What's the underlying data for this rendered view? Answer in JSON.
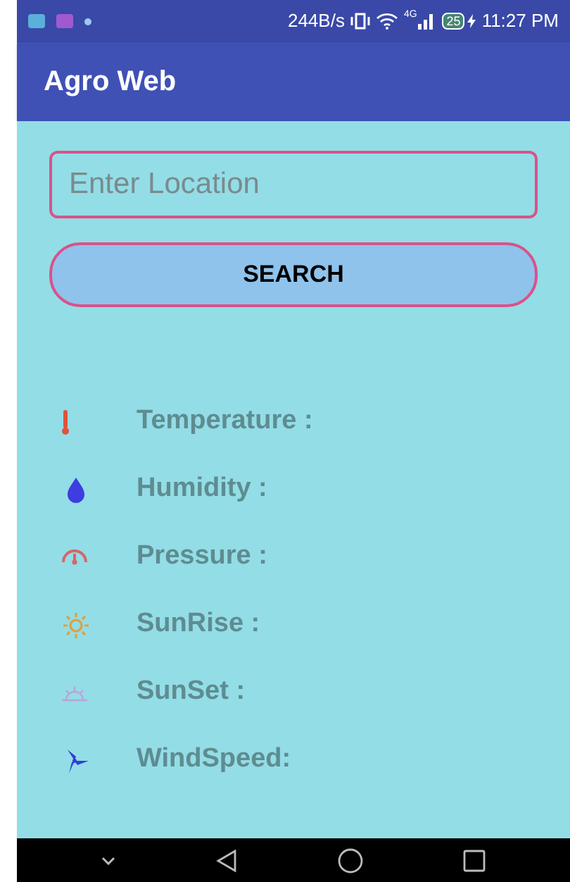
{
  "status_bar": {
    "speed": "244B/s",
    "network": "4G",
    "battery": "25",
    "time": "11:27 PM"
  },
  "app_bar": {
    "title": "Agro Web"
  },
  "location_field": {
    "placeholder": "Enter Location"
  },
  "search_button": {
    "label": "SEARCH"
  },
  "weather_rows": [
    {
      "kind": "temperature",
      "label": "Temperature :"
    },
    {
      "kind": "humidity",
      "label": "Humidity :"
    },
    {
      "kind": "pressure",
      "label": "Pressure :"
    },
    {
      "kind": "sunrise",
      "label": "SunRise :"
    },
    {
      "kind": "sunset",
      "label": "SunSet :"
    },
    {
      "kind": "wind",
      "label": "WindSpeed:"
    }
  ]
}
